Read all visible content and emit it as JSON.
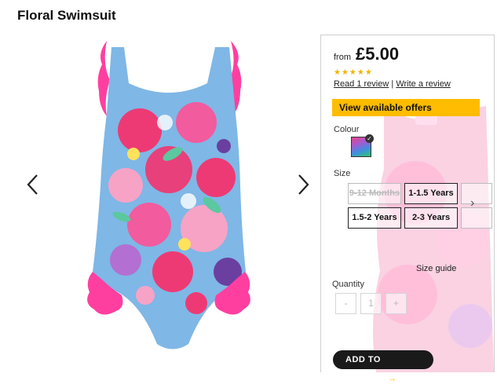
{
  "product": {
    "title": "Floral Swimsuit"
  },
  "gallery": {
    "prev_icon": "chevron-left-icon",
    "next_icon": "chevron-right-icon"
  },
  "pricing": {
    "from_label": "from",
    "price": "£5.00",
    "stars": "★★★★★",
    "rating": 5
  },
  "reviews": {
    "read": "Read 1 review",
    "separator": "|",
    "write": "Write a review"
  },
  "offers": {
    "label": "View available offers"
  },
  "colour": {
    "label": "Colour"
  },
  "size": {
    "label": "Size",
    "options": [
      "9-12 Months",
      "1-1.5 Years",
      "1.5-2 Years",
      "2-3 Years"
    ]
  },
  "size_guide": {
    "label": "Size guide"
  },
  "quantity": {
    "label": "Quantity",
    "minus": "-",
    "value": "1",
    "plus": "+"
  },
  "basket": {
    "label": "ADD TO BASKET",
    "arrow": "→"
  },
  "colors": {
    "accent": "#ffbc00",
    "button": "#1a1a1a",
    "pink": "#ff3fa0"
  }
}
